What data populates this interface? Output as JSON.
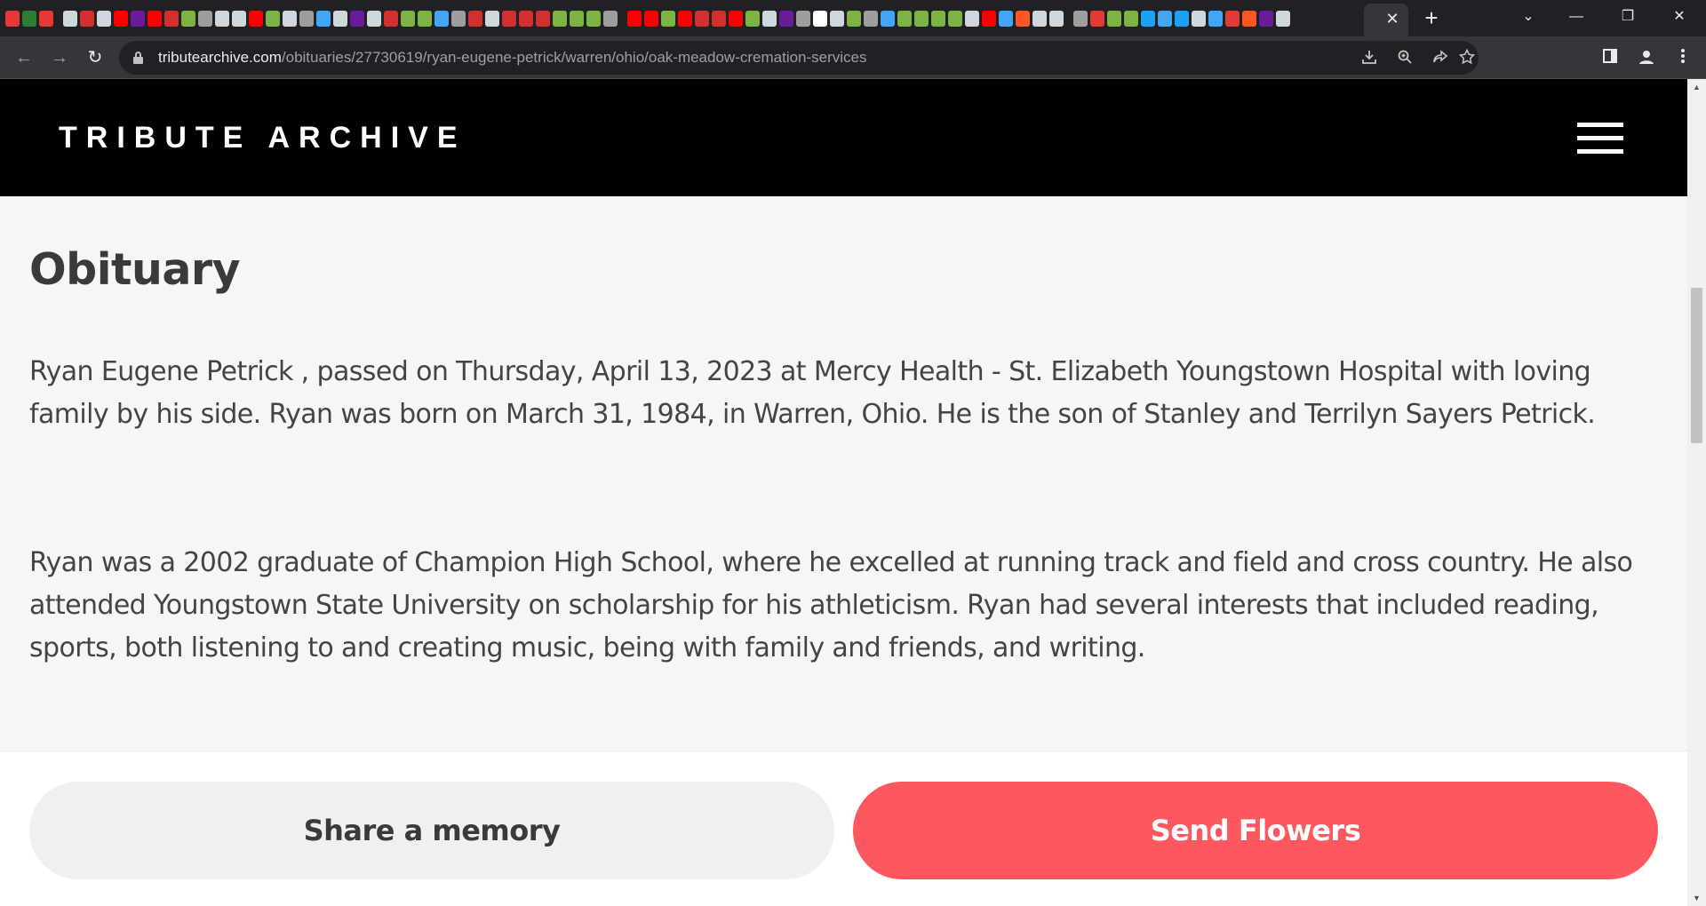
{
  "browser": {
    "tab_close_glyph": "✕",
    "new_tab_glyph": "+",
    "window_controls": {
      "tab_search": "⌄",
      "minimize": "—",
      "restore": "❐",
      "close": "✕"
    },
    "nav": {
      "back": "←",
      "forward": "→",
      "reload": "↻"
    },
    "url_host": "tributearchive.com",
    "url_path": "/obituaries/27730619/ryan-eugene-petrick/warren/ohio/oak-meadow-cremation-services",
    "omnibox_icons": [
      "download-icon",
      "zoom-icon",
      "share-icon",
      "star-icon"
    ],
    "toolbar_icons": [
      "side-panel-icon",
      "profile-icon",
      "menu-icon"
    ],
    "favicon_colors": [
      "#e53935",
      "#2e7d32",
      "#e53935",
      "#cfd8dc",
      "#d32f2f",
      "#cfd8dc",
      "#ff0000",
      "#6a1b9a",
      "#ff0000",
      "#d32f2f",
      "#7cb342",
      "#9e9e9e",
      "#cfd8dc",
      "#cfd8dc",
      "#ff0000",
      "#7cb342",
      "#cfd8dc",
      "#9e9e9e",
      "#42a5f5",
      "#cfd8dc",
      "#6a1b9a",
      "#cfd8dc",
      "#d32f2f",
      "#7cb342",
      "#7cb342",
      "#42a5f5",
      "#9e9e9e",
      "#d32f2f",
      "#cfd8dc",
      "#d32f2f",
      "#d32f2f",
      "#d32f2f",
      "#7cb342",
      "#7cb342",
      "#7cb342",
      "#9e9e9e",
      "#ff0000",
      "#ff0000",
      "#7cb342",
      "#ff0000",
      "#d32f2f",
      "#d32f2f",
      "#ff0000",
      "#7cb342",
      "#cfd8dc",
      "#6a1b9a",
      "#9e9e9e",
      "#ffffff",
      "#cfd8dc",
      "#7cb342",
      "#9e9e9e",
      "#42a5f5",
      "#7cb342",
      "#7cb342",
      "#7cb342",
      "#7cb342",
      "#cfd8dc",
      "#ff0000",
      "#42a5f5",
      "#ff5722",
      "#cfd8dc",
      "#cfd8dc",
      "#9e9e9e",
      "#e53935",
      "#7cb342",
      "#7cb342",
      "#1da1f2",
      "#42a5f5",
      "#1da1f2",
      "#cfd8dc",
      "#42a5f5",
      "#e53935",
      "#ff5722",
      "#6a1b9a",
      "#cfd8dc"
    ]
  },
  "site": {
    "logo": "TRIBUTE ARCHIVE"
  },
  "obituary": {
    "title": "Obituary",
    "paragraphs": [
      "Ryan Eugene Petrick , passed on Thursday, April 13, 2023 at Mercy Health - St. Elizabeth Youngstown Hospital with loving family by his side. Ryan was born on March 31, 1984, in Warren, Ohio. He is the son of Stanley and Terrilyn Sayers Petrick.",
      "Ryan was a 2002 graduate of Champion High School, where he excelled at running track and field and cross country. He also attended Youngstown State University on scholarship for his athleticism. Ryan had several interests that included reading, sports, both listening to and creating music, being with family and friends, and writing."
    ]
  },
  "actions": {
    "share_label": "Share a memory",
    "flowers_label": "Send Flowers"
  },
  "colors": {
    "header_bg": "#000000",
    "page_bg": "#f6f6f6",
    "flowers_button": "#fd5760",
    "share_button": "#f0f0f0"
  },
  "scrollbar": {
    "up": "▲",
    "down": "▼"
  }
}
